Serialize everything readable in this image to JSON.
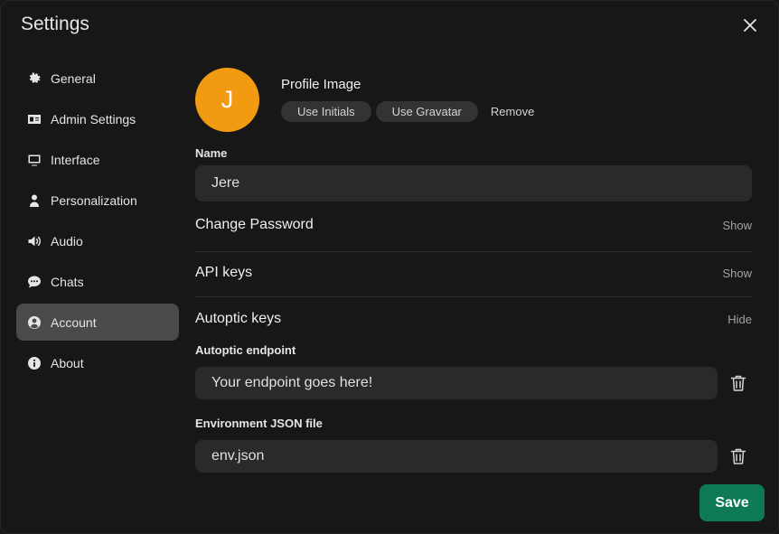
{
  "dialog": {
    "title": "Settings"
  },
  "nav": {
    "items": [
      {
        "label": "General",
        "icon": "gear-icon"
      },
      {
        "label": "Admin Settings",
        "icon": "id-card-icon"
      },
      {
        "label": "Interface",
        "icon": "monitor-icon"
      },
      {
        "label": "Personalization",
        "icon": "person-icon"
      },
      {
        "label": "Audio",
        "icon": "speaker-icon"
      },
      {
        "label": "Chats",
        "icon": "chat-bubble-icon"
      },
      {
        "label": "Account",
        "icon": "user-circle-icon",
        "active": true
      },
      {
        "label": "About",
        "icon": "info-icon"
      }
    ]
  },
  "profile": {
    "initial": "J",
    "avatar_color": "#f29b12",
    "label": "Profile Image",
    "use_initials": "Use Initials",
    "use_gravatar": "Use Gravatar",
    "remove": "Remove"
  },
  "name": {
    "label": "Name",
    "value": "Jere"
  },
  "change_password": {
    "title": "Change Password",
    "action": "Show"
  },
  "api_keys": {
    "title": "API keys",
    "action": "Show"
  },
  "autoptic": {
    "title": "Autoptic keys",
    "action": "Hide",
    "endpoint_label": "Autoptic endpoint",
    "endpoint_value": "Your endpoint goes here!",
    "env_label": "Environment JSON file",
    "env_value": "env.json"
  },
  "save_label": "Save",
  "colors": {
    "accent": "#0d7a55",
    "active_nav": "#4a4a4a"
  }
}
